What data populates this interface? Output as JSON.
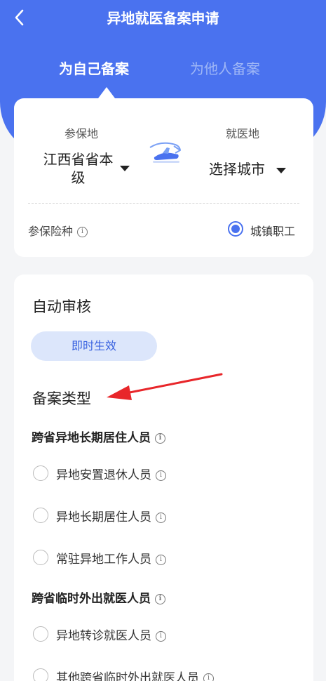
{
  "header": {
    "title": "异地就医备案申请",
    "tabs": [
      {
        "label": "为自己备案",
        "active": true
      },
      {
        "label": "为他人备案",
        "active": false
      }
    ]
  },
  "location": {
    "insured_label": "参保地",
    "insured_value": "江西省省本级",
    "medical_label": "就医地",
    "medical_value": "选择城市",
    "insurance_type_label": "参保险种",
    "insurance_type_value": "城镇职工"
  },
  "review": {
    "title": "自动审核",
    "badge": "即时生效"
  },
  "filing": {
    "title": "备案类型",
    "groups": [
      {
        "title": "跨省异地长期居住人员",
        "options": [
          "异地安置退休人员",
          "异地长期居住人员",
          "常驻异地工作人员"
        ]
      },
      {
        "title": "跨省临时外出就医人员",
        "options": [
          "异地转诊就医人员",
          "其他跨省临时外出就医人员"
        ]
      }
    ]
  },
  "colors": {
    "primary": "#4a72ef",
    "pill_bg": "#dce6fb",
    "annotation_arrow": "#e8262a"
  }
}
